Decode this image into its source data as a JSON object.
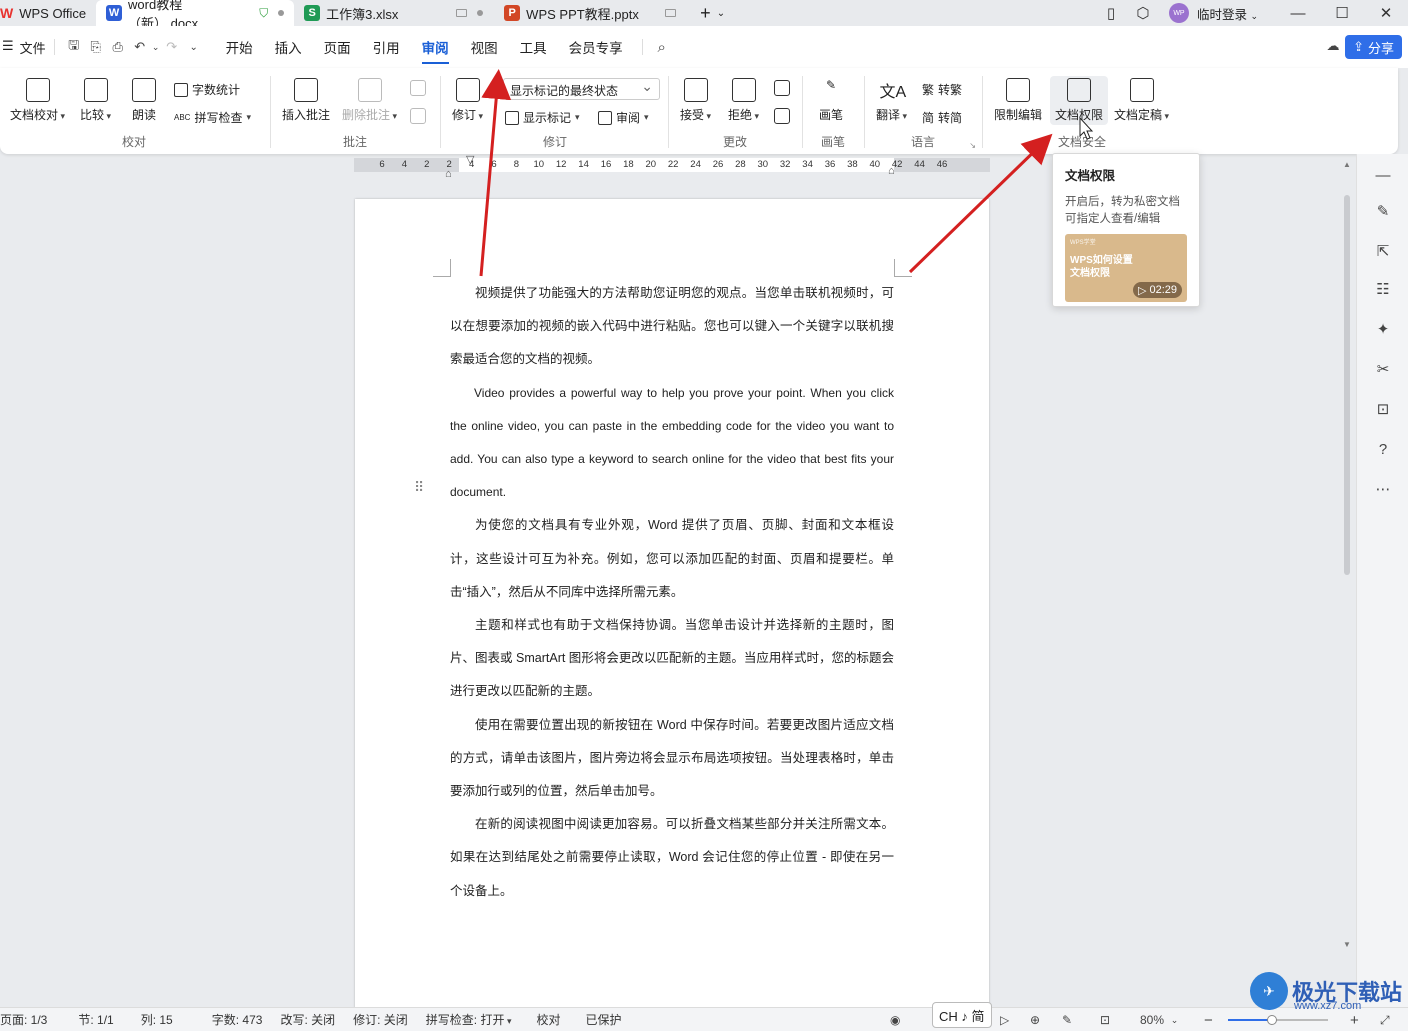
{
  "tabs": [
    {
      "label": "WPS Office",
      "icon": "wps-logo-icon",
      "color": "#e8332f"
    },
    {
      "label": "word教程（新）.docx",
      "icon": "word-doc-icon",
      "color": "#2f5fd6"
    },
    {
      "label": "工作簿3.xlsx",
      "icon": "sheet-icon",
      "color": "#1f9a55"
    },
    {
      "label": "WPS PPT教程.pptx",
      "icon": "ppt-icon",
      "color": "#d24726"
    }
  ],
  "tab_letters": {
    "word": "W",
    "sheet": "S",
    "ppt": "P"
  },
  "header_right": {
    "login": "临时登录",
    "avatar": "WP"
  },
  "menu": {
    "file": "文件",
    "items": [
      "开始",
      "插入",
      "页面",
      "引用",
      "审阅",
      "视图",
      "工具",
      "会员专享"
    ],
    "active": "审阅",
    "share": "分享"
  },
  "ribbon": {
    "proof": {
      "group": "校对",
      "doc_check": "文档校对",
      "compare": "比较",
      "read": "朗读",
      "word_count": "字数统计",
      "spell_check": "拼写检查"
    },
    "comment": {
      "group": "批注",
      "insert": "插入批注",
      "delete": "删除批注"
    },
    "revise": {
      "group": "修订",
      "revise": "修订",
      "display_select": "显示标记的最终状态",
      "show_marks": "显示标记",
      "review": "审阅"
    },
    "change": {
      "group": "更改",
      "accept": "接受",
      "reject": "拒绝"
    },
    "pen": {
      "group": "画笔",
      "pen": "画笔"
    },
    "lang": {
      "group": "语言",
      "translate": "翻译",
      "to_trad": "转繁",
      "to_simp": "转简"
    },
    "security": {
      "group": "文档安全",
      "restrict": "限制编辑",
      "permission": "文档权限",
      "finalize": "文档定稿"
    }
  },
  "ruler_ticks": [
    "6",
    "4",
    "2",
    "2",
    "4",
    "6",
    "8",
    "10",
    "12",
    "14",
    "16",
    "18",
    "20",
    "22",
    "24",
    "26",
    "28",
    "30",
    "32",
    "34",
    "36",
    "38",
    "40",
    "42",
    "44",
    "46"
  ],
  "tooltip": {
    "title": "文档权限",
    "desc": "开启后，转为私密文档可指定人查看/编辑",
    "thumb_small": "WPS学堂",
    "thumb_title": "WPS如何设置文档权限",
    "duration": "02:29"
  },
  "document": {
    "paragraphs": [
      "视频提供了功能强大的方法帮助您证明您的观点。当您单击联机视频时，可以在想要添加的视频的嵌入代码中进行粘贴。您也可以键入一个关键字以联机搜索最适合您的文档的视频。",
      "Video provides a powerful way to help you prove your point. When you click the online video, you can paste in the embedding code for the video you want to add. You can also type a keyword to search online for the video that best fits your document.",
      "为使您的文档具有专业外观，Word 提供了页眉、页脚、封面和文本框设计，这些设计可互为补充。例如，您可以添加匹配的封面、页眉和提要栏。单击“插入”，然后从不同库中选择所需元素。",
      "主题和样式也有助于文档保持协调。当您单击设计并选择新的主题时，图片、图表或 SmartArt 图形将会更改以匹配新的主题。当应用样式时，您的标题会进行更改以匹配新的主题。",
      "使用在需要位置出现的新按钮在 Word 中保存时间。若要更改图片适应文档的方式，请单击该图片，图片旁边将会显示布局选项按钮。当处理表格时，单击要添加行或列的位置，然后单击加号。",
      "在新的阅读视图中阅读更加容易。可以折叠文档某些部分并关注所需文本。如果在达到结尾处之前需要停止读取，Word 会记住您的停止位置 - 即使在另一个设备上。"
    ]
  },
  "status": {
    "page": "页面: 1/3",
    "section": "节: 1/1",
    "col": "列: 15",
    "words": "字数: 473",
    "track": "改写: 关闭",
    "revise": "修订: 关闭",
    "spell": "拼写检查: 打开",
    "proof": "校对",
    "protected": "已保护",
    "ime": "CH ♪ 简",
    "zoom": "80%",
    "zoom_level": 0.44
  },
  "watermark": {
    "text": "极光下载站",
    "sub": "www.xz7.com"
  },
  "colors": {
    "accent": "#1a5fd6",
    "share": "#2f6ee8",
    "arrow": "#d42020"
  }
}
